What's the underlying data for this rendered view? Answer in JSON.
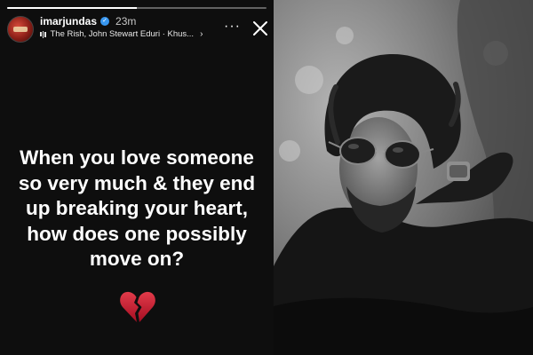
{
  "story": {
    "username": "imarjundas",
    "time": "23m",
    "music": "The Rish, John Stewart Eduri · Khus...",
    "text": "When you love someone so very much & they end up breaking your heart, how does one possibly move on?",
    "progress": 0.5,
    "icons": {
      "verified": "verified-badge-icon",
      "music": "music-bars-icon",
      "more": "more-dots-icon",
      "close": "close-icon",
      "emoji": "broken-heart-icon"
    },
    "colors": {
      "background": "#0e0e0e",
      "text": "#ffffff",
      "verified": "#3897f0",
      "heart": "#c8102e"
    }
  },
  "photo": {
    "description_icon": "portrait-photo"
  }
}
